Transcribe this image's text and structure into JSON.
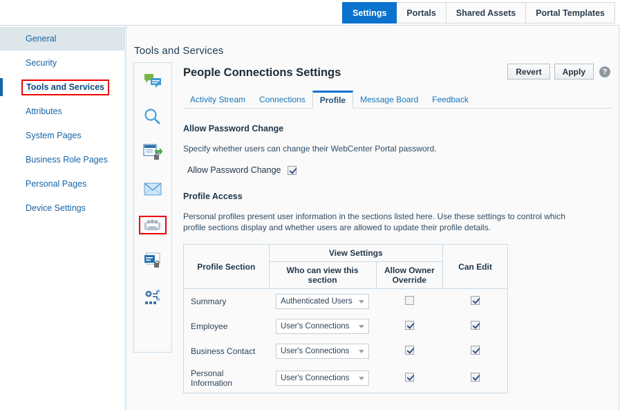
{
  "top_tabs": [
    {
      "label": "Settings",
      "active": true
    },
    {
      "label": "Portals",
      "active": false
    },
    {
      "label": "Shared Assets",
      "active": false
    },
    {
      "label": "Portal Templates",
      "active": false
    }
  ],
  "sidebar": {
    "items": [
      {
        "label": "General",
        "state": "selected"
      },
      {
        "label": "Security",
        "state": "normal"
      },
      {
        "label": "Tools and Services",
        "state": "current"
      },
      {
        "label": "Attributes",
        "state": "normal"
      },
      {
        "label": "System Pages",
        "state": "normal"
      },
      {
        "label": "Business Role Pages",
        "state": "normal"
      },
      {
        "label": "Personal Pages",
        "state": "normal"
      },
      {
        "label": "Device Settings",
        "state": "normal"
      }
    ]
  },
  "panel": {
    "title": "Tools and Services"
  },
  "icon_rail": [
    {
      "icon": "discussions-icon",
      "selected": false
    },
    {
      "icon": "search-icon",
      "selected": false
    },
    {
      "icon": "documents-icon",
      "selected": false
    },
    {
      "icon": "mail-icon",
      "selected": false
    },
    {
      "icon": "people-connections-icon",
      "selected": true
    },
    {
      "icon": "notes-icon",
      "selected": false
    },
    {
      "icon": "worklist-icon",
      "selected": false
    }
  ],
  "actions": {
    "revert_label": "Revert",
    "apply_label": "Apply",
    "help_label": "?"
  },
  "content": {
    "title": "People Connections Settings",
    "tabs": [
      {
        "label": "Activity Stream",
        "active": false
      },
      {
        "label": "Connections",
        "active": false
      },
      {
        "label": "Profile",
        "active": true
      },
      {
        "label": "Message Board",
        "active": false
      },
      {
        "label": "Feedback",
        "active": false
      }
    ],
    "password_section": {
      "heading": "Allow Password Change",
      "description": "Specify whether users can change their WebCenter Portal password.",
      "field_label": "Allow Password Change",
      "checked": true
    },
    "profile_access": {
      "heading": "Profile Access",
      "description": "Personal profiles present user information in the sections listed here. Use these settings to control which profile sections display and whether users are allowed to update their profile details.",
      "table": {
        "headers": {
          "profile_section": "Profile Section",
          "view_settings": "View Settings",
          "who_can_view": "Who can view this section",
          "allow_owner_override": "Allow Owner Override",
          "can_edit": "Can Edit"
        },
        "rows": [
          {
            "section": "Summary",
            "who_can_view": "Authenticated Users",
            "allow_owner_override": false,
            "can_edit": true
          },
          {
            "section": "Employee",
            "who_can_view": "User's Connections",
            "allow_owner_override": true,
            "can_edit": true
          },
          {
            "section": "Business Contact",
            "who_can_view": "User's Connections",
            "allow_owner_override": true,
            "can_edit": true
          },
          {
            "section": "Personal Information",
            "who_can_view": "User's Connections",
            "allow_owner_override": true,
            "can_edit": true
          }
        ]
      }
    }
  },
  "colors": {
    "accent_blue": "#0b72ce",
    "link_blue": "#1565a7",
    "highlight_red": "#ee0000",
    "panel_bg": "#fafafa"
  }
}
